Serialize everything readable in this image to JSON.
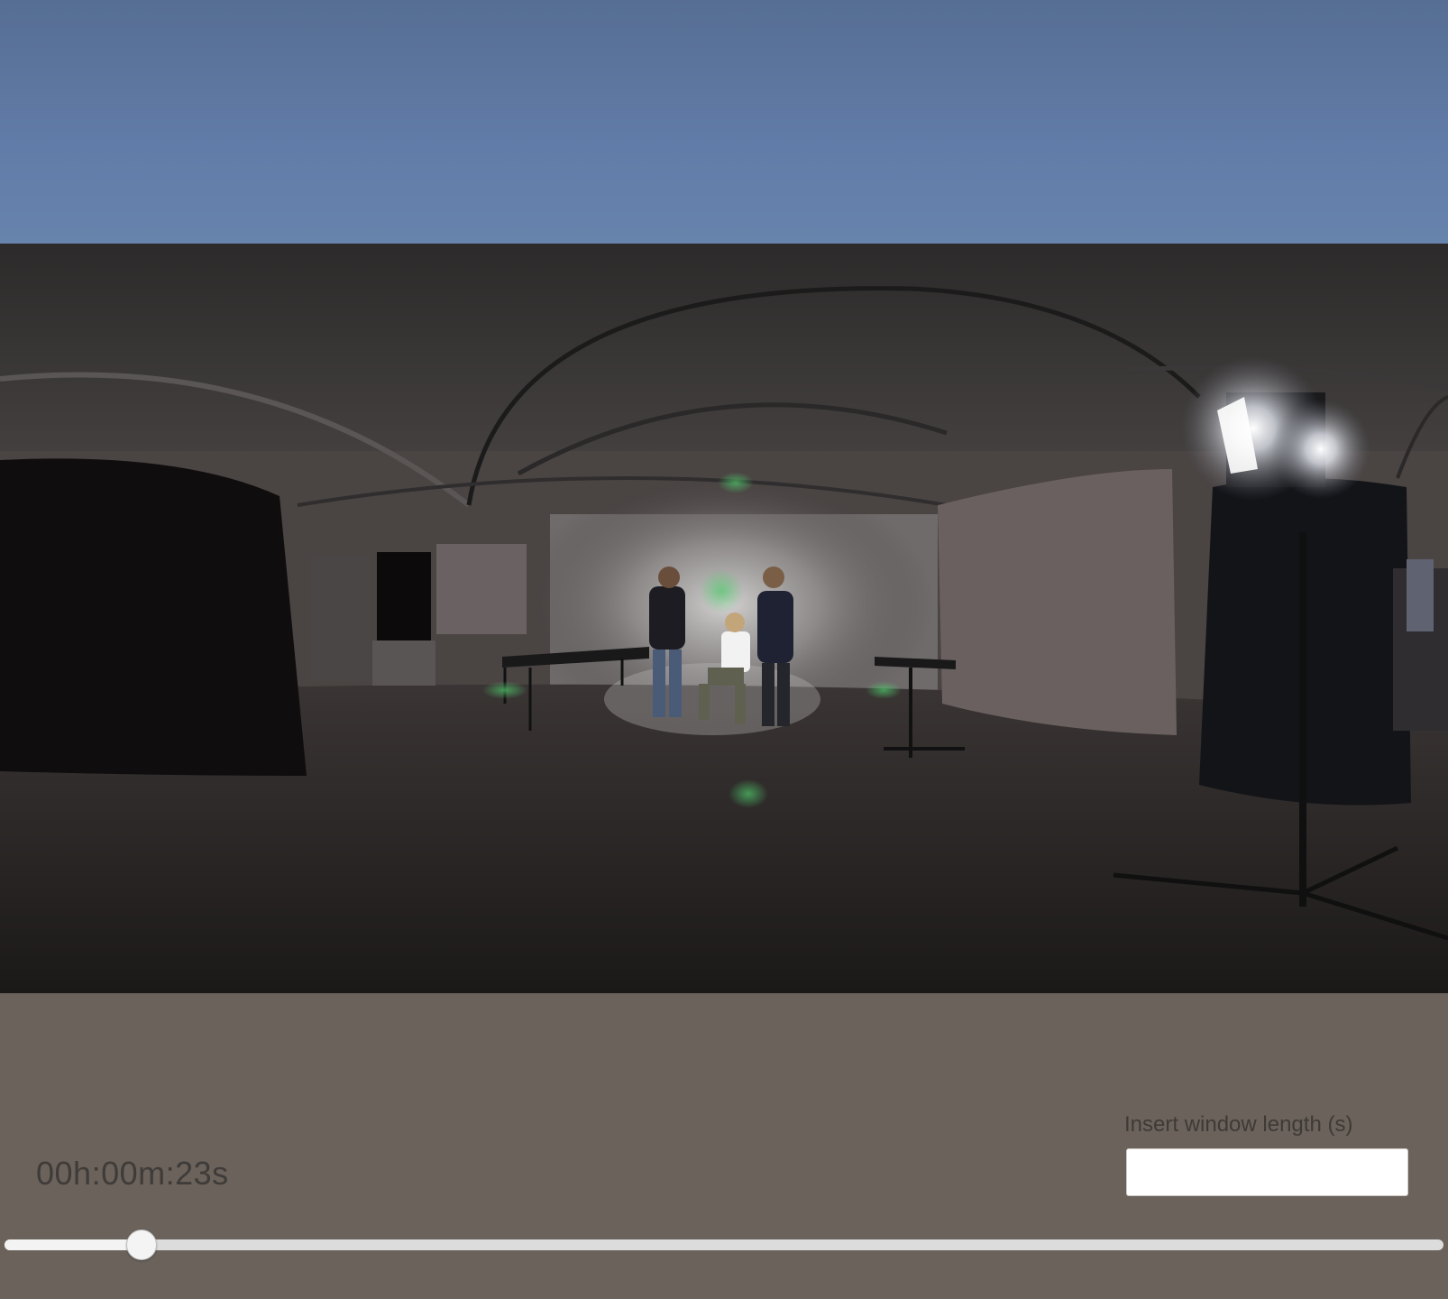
{
  "video": {
    "description_icon": "360-panorama-video",
    "elapsed_time": "00h:00m:23s",
    "progress_fraction": 0.095
  },
  "window_length": {
    "label": "Insert window length (s)",
    "value": ""
  },
  "colors": {
    "sky": "#617ca8",
    "panel": "#6a625b",
    "text": "#3f3b38",
    "slider_track": "#dcdcdc",
    "slider_thumb": "#f4f4f4"
  }
}
